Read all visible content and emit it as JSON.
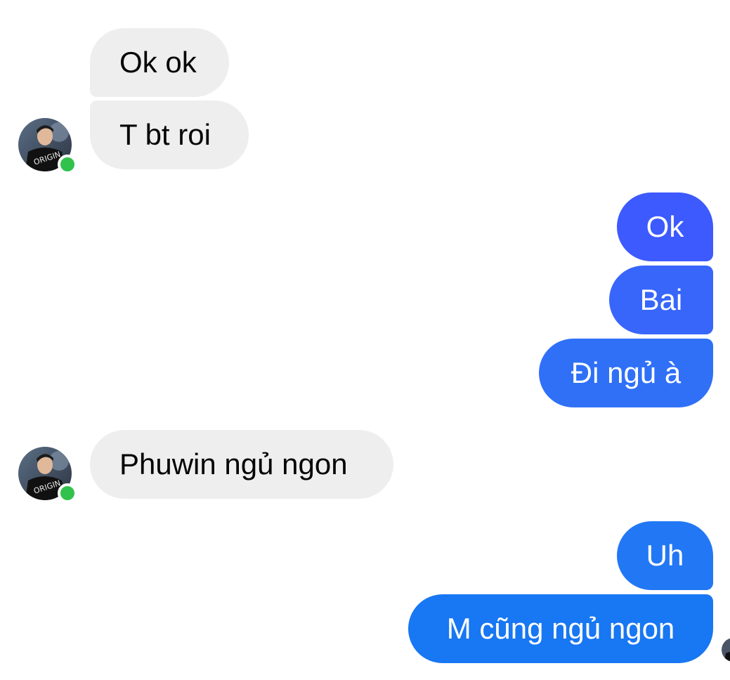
{
  "colors": {
    "incoming_bg": "#eeeeee",
    "incoming_text": "#050505",
    "outgoing_gradient_top": "#3d5afe",
    "outgoing_gradient_bottom": "#1877f2",
    "online": "#31c24d"
  },
  "messages": [
    {
      "side": "in",
      "text": "Ok ok"
    },
    {
      "side": "in",
      "text": "T bt roi"
    },
    {
      "side": "out",
      "text": "Ok"
    },
    {
      "side": "out",
      "text": "Bai"
    },
    {
      "side": "out",
      "text": "Đi ngủ à"
    },
    {
      "side": "in",
      "text": "Phuwin ngủ ngon"
    },
    {
      "side": "out",
      "text": "Uh"
    },
    {
      "side": "out",
      "text": "M cũng ngủ ngon"
    }
  ],
  "avatar": {
    "icon": "contact-avatar-icon",
    "online": true
  },
  "seen_indicator": {
    "icon": "seen-avatar-icon"
  }
}
